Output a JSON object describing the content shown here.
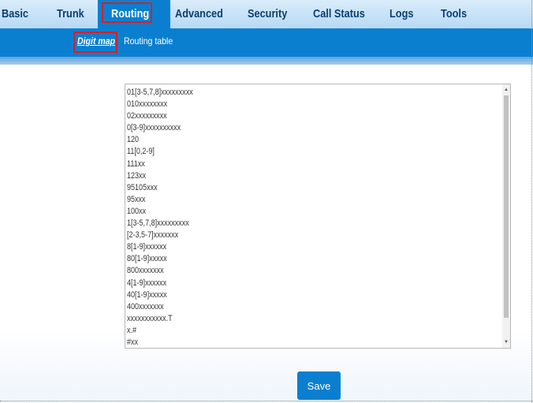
{
  "nav": {
    "tabs": [
      {
        "label": "Basic"
      },
      {
        "label": "Trunk"
      },
      {
        "label": "Routing",
        "active": true
      },
      {
        "label": "Advanced"
      },
      {
        "label": "Security"
      },
      {
        "label": "Call Status"
      },
      {
        "label": "Logs"
      },
      {
        "label": "Tools"
      }
    ]
  },
  "subnav": {
    "items": [
      {
        "label": "Digit map",
        "active": true
      },
      {
        "label": "Routing table"
      }
    ]
  },
  "digitmap": {
    "lines": [
      "01[3-5,7,8]xxxxxxxxx",
      "010xxxxxxxx",
      "02xxxxxxxxx",
      "0[3-9]xxxxxxxxxx",
      "120",
      "11[0,2-9]",
      "111xx",
      "123xx",
      "95105xxx",
      "95xxx",
      "100xx",
      "1[3-5,7,8]xxxxxxxxx",
      "[2-3,5-7]xxxxxxx",
      "8[1-9]xxxxxx",
      "80[1-9]xxxxx",
      "800xxxxxxx",
      "4[1-9]xxxxxx",
      "40[1-9]xxxxx",
      "400xxxxxxx",
      "xxxxxxxxxxx.T",
      "x.#",
      "#xx"
    ]
  },
  "actions": {
    "save_label": "Save"
  },
  "colors": {
    "accent": "#0a7fd0",
    "highlight_border": "#d3212b",
    "nav_text": "#0a3f74"
  }
}
